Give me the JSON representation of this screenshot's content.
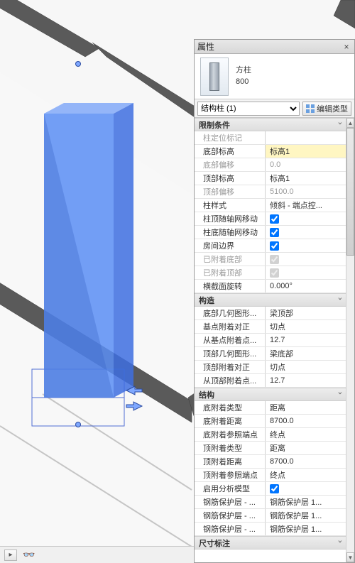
{
  "panel": {
    "title": "属性"
  },
  "type": {
    "family": "方柱",
    "size": "800"
  },
  "filter": {
    "selected": "结构柱 (1)",
    "edit_type": "编辑类型"
  },
  "groups": {
    "constraints": {
      "header": "限制条件",
      "rows": {
        "loc_mark": {
          "label": "柱定位标记",
          "value": ""
        },
        "base_level": {
          "label": "底部标高",
          "value": "标高1"
        },
        "base_offset": {
          "label": "底部偏移",
          "value": "0.0"
        },
        "top_level": {
          "label": "顶部标高",
          "value": "标高1"
        },
        "top_offset": {
          "label": "顶部偏移",
          "value": "5100.0"
        },
        "col_style": {
          "label": "柱样式",
          "value": "倾斜 - 端点控..."
        },
        "top_grid": {
          "label": "柱顶随轴网移动",
          "checked": true
        },
        "base_grid": {
          "label": "柱底随轴网移动",
          "checked": true
        },
        "room_bound": {
          "label": "房间边界",
          "checked": true
        },
        "attached_base": {
          "label": "已附着底部",
          "checked": true
        },
        "attached_top": {
          "label": "已附着顶部",
          "checked": true
        },
        "cross_rot": {
          "label": "横截面旋转",
          "value": "0.000°"
        }
      }
    },
    "construction": {
      "header": "构造",
      "rows": {
        "base_cut": {
          "label": "底部几何图形...",
          "value": "梁顶部"
        },
        "base_just": {
          "label": "基点附着对正",
          "value": "切点"
        },
        "from_base": {
          "label": "从基点附着点...",
          "value": "12.7"
        },
        "top_cut": {
          "label": "顶部几何图形...",
          "value": "梁底部"
        },
        "top_just": {
          "label": "顶部附着对正",
          "value": "切点"
        },
        "from_top": {
          "label": "从顶部附着点...",
          "value": "12.7"
        }
      }
    },
    "structural": {
      "header": "结构",
      "rows": {
        "base_attach_type": {
          "label": "底附着类型",
          "value": "距离"
        },
        "base_attach_dist": {
          "label": "底附着距离",
          "value": "8700.0"
        },
        "base_attach_ref": {
          "label": "底附着参照端点",
          "value": "终点"
        },
        "top_attach_type": {
          "label": "顶附着类型",
          "value": "距离"
        },
        "top_attach_dist": {
          "label": "顶附着距离",
          "value": "8700.0"
        },
        "top_attach_ref": {
          "label": "顶附着参照端点",
          "value": "终点"
        },
        "analytical": {
          "label": "启用分析模型",
          "checked": true
        },
        "rebar1": {
          "label": "钢筋保护层 - ...",
          "value": "钢筋保护层 1..."
        },
        "rebar2": {
          "label": "钢筋保护层 - ...",
          "value": "钢筋保护层 1..."
        },
        "rebar3": {
          "label": "钢筋保护层 - ...",
          "value": "钢筋保护层 1..."
        }
      }
    },
    "dimensions": {
      "header": "尺寸标注"
    }
  }
}
